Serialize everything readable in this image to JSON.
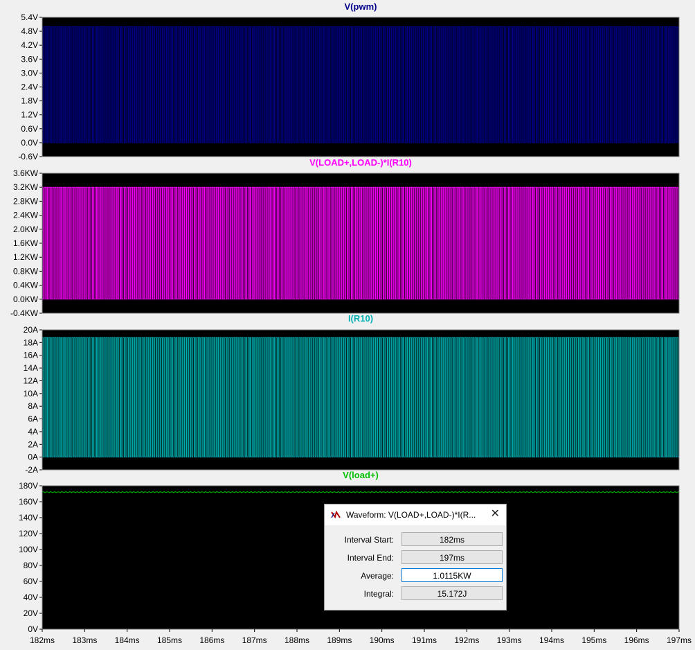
{
  "colors": {
    "background": "#000000",
    "grid": "#000000",
    "axis_text": "#000000",
    "frame": "#7f7f7f"
  },
  "x_axis": {
    "ticks": [
      "182ms",
      "183ms",
      "184ms",
      "185ms",
      "186ms",
      "187ms",
      "188ms",
      "189ms",
      "190ms",
      "191ms",
      "192ms",
      "193ms",
      "194ms",
      "195ms",
      "196ms",
      "197ms"
    ]
  },
  "chart_data": [
    {
      "type": "line",
      "title": "V(pwm)",
      "color": "#00008b",
      "unit": "V",
      "y_ticks": [
        "5.4V",
        "4.8V",
        "4.2V",
        "3.6V",
        "3.0V",
        "2.4V",
        "1.8V",
        "1.2V",
        "0.6V",
        "0.0V",
        "-0.6V"
      ],
      "ylim": [
        -0.6,
        5.4
      ],
      "x_range_ms": [
        182,
        197
      ],
      "series": [
        {
          "signal": "pwm square wave",
          "low": 0.0,
          "high": 5.0,
          "cycles": 300
        }
      ]
    },
    {
      "type": "line",
      "title": "V(LOAD+,LOAD-)*I(R10)",
      "color": "#ff00ff",
      "unit": "KW",
      "y_ticks": [
        "3.6KW",
        "3.2KW",
        "2.8KW",
        "2.4KW",
        "2.0KW",
        "1.6KW",
        "1.2KW",
        "0.8KW",
        "0.4KW",
        "0.0KW",
        "-0.4KW"
      ],
      "ylim": [
        -0.4,
        3.6
      ],
      "x_range_ms": [
        182,
        197
      ],
      "series": [
        {
          "signal": "power pulse train",
          "low": 0.0,
          "high": 3.2,
          "cycles": 300
        }
      ]
    },
    {
      "type": "line",
      "title": "I(R10)",
      "color": "#00b0b0",
      "unit": "A",
      "y_ticks": [
        "20A",
        "18A",
        "16A",
        "14A",
        "12A",
        "10A",
        "8A",
        "6A",
        "4A",
        "2A",
        "0A",
        "-2A"
      ],
      "ylim": [
        -2,
        20
      ],
      "x_range_ms": [
        182,
        197
      ],
      "series": [
        {
          "signal": "current pulse train",
          "low": 0.0,
          "high": 18.8,
          "cycles": 300
        }
      ]
    },
    {
      "type": "line",
      "title": "V(load+)",
      "color": "#00c000",
      "unit": "V",
      "y_ticks": [
        "180V",
        "160V",
        "140V",
        "120V",
        "100V",
        "80V",
        "60V",
        "40V",
        "20V",
        "0V"
      ],
      "ylim": [
        0,
        180
      ],
      "x_range_ms": [
        182,
        197
      ],
      "series": [
        {
          "signal": "dc with ripple",
          "level": 172,
          "ripple": 0.8
        }
      ]
    }
  ],
  "dialog": {
    "title": "Waveform: V(LOAD+,LOAD-)*I(R...",
    "close_symbol": "✕",
    "icon": "waveform-icon",
    "rows": [
      {
        "label": "Interval Start:",
        "value": "182ms"
      },
      {
        "label": "Interval End:",
        "value": "197ms"
      },
      {
        "label": "Average:",
        "value": "1.0115KW"
      },
      {
        "label": "Integral:",
        "value": "15.172J"
      }
    ]
  }
}
